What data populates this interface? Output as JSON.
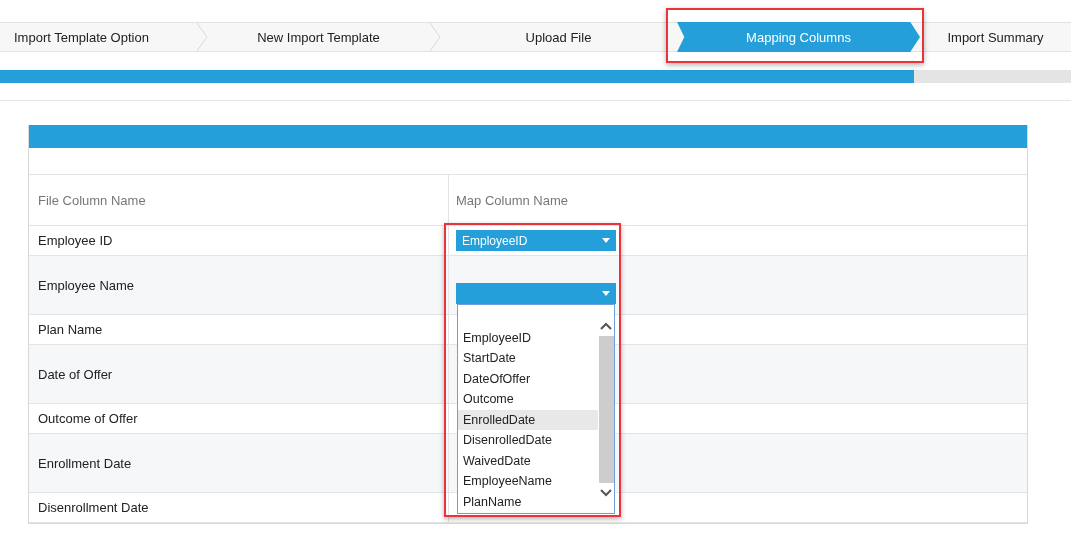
{
  "steps": [
    {
      "label": "Import Template Option",
      "selected": false
    },
    {
      "label": "New Import Template",
      "selected": false
    },
    {
      "label": "Upload File",
      "selected": false
    },
    {
      "label": "Mapping Columns",
      "selected": true
    },
    {
      "label": "Import Summary",
      "selected": false
    }
  ],
  "progress": {
    "level": 0.853
  },
  "table": {
    "columns": [
      "File Column Name",
      "Map Column Name"
    ],
    "rows": [
      {
        "name": "Employee ID",
        "mapping": "EmployeeID",
        "open": false
      },
      {
        "name": "Employee Name",
        "open": true
      },
      {
        "name": "Plan Name"
      },
      {
        "name": "Date of Offer"
      },
      {
        "name": "Outcome of Offer"
      },
      {
        "name": "Enrollment Date"
      },
      {
        "name": "Disenrollment Date"
      }
    ]
  },
  "dropdown_options": [
    {
      "label": "EmployeeID",
      "selected": false
    },
    {
      "label": "StartDate",
      "selected": false
    },
    {
      "label": "DateOfOffer",
      "selected": false
    },
    {
      "label": "Outcome",
      "selected": false
    },
    {
      "label": "EnrolledDate",
      "selected": true
    },
    {
      "label": "DisenrolledDate",
      "selected": false
    },
    {
      "label": "WaivedDate",
      "selected": false
    },
    {
      "label": "EmployeeName",
      "selected": false
    },
    {
      "label": "PlanName",
      "selected": false
    }
  ]
}
